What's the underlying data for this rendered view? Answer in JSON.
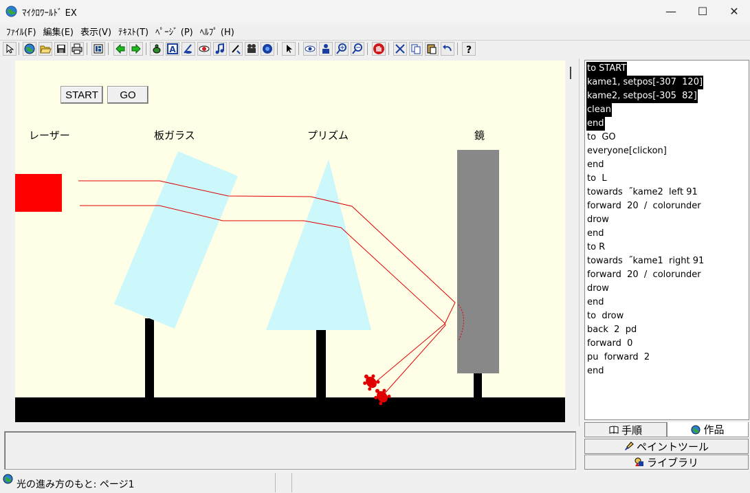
{
  "window": {
    "title": "ﾏｲｸﾛﾜｰﾙﾄﾞ EX",
    "minimize_glyph": "—",
    "maximize_glyph": "☐",
    "close_glyph": "✕"
  },
  "menu": {
    "file": "ﾌｧｲﾙ(F)",
    "edit": "編集(E)",
    "view": "表示(V)",
    "text": "ﾃｷｽﾄ(T)",
    "page": "ﾍﾟｰｼﾞ (P)",
    "help": "ﾍﾙﾌﾟ (H)"
  },
  "toolbar": {
    "icons": [
      "select-arrow-icon",
      "globe-icon",
      "open-folder-icon",
      "save-disk-icon",
      "print-icon",
      "page-icon",
      "arrow-left-icon",
      "arrow-right-icon",
      "turtle-icon",
      "text-box-icon",
      "pen-turtle-icon",
      "eye-stamp-icon",
      "music-note-icon",
      "paint-icon",
      "video-camera-icon",
      "record-icon",
      "pointer-icon",
      "eye-icon",
      "person-icon",
      "zoom-in-icon",
      "zoom-out-icon",
      "stop-hand-icon",
      "cut-icon",
      "copy-icon",
      "paste-icon",
      "undo-icon",
      "help-icon"
    ]
  },
  "canvas": {
    "start_button": "START",
    "go_button": "GO",
    "label_laser": "レーザー",
    "label_glass": "板ガラス",
    "label_prism": "プリズム",
    "label_mirror": "鏡",
    "colors": {
      "background": "#ffffe8",
      "laser": "#ff0000",
      "glass": "#ccf8fc",
      "mirror": "#888888",
      "ground": "#000000"
    }
  },
  "code": {
    "lines": [
      {
        "text": "to START",
        "selected": true
      },
      {
        "text": "kame1, setpos[-307  120]",
        "selected": true
      },
      {
        "text": "kame2, setpos[-305  82]",
        "selected": true
      },
      {
        "text": "clean",
        "selected": true
      },
      {
        "text": "end",
        "selected": true
      },
      {
        "text": "to  GO",
        "selected": false
      },
      {
        "text": "everyone[clickon]",
        "selected": false
      },
      {
        "text": "end",
        "selected": false
      },
      {
        "text": "to  L",
        "selected": false
      },
      {
        "text": "towards  ˝kame2  left 91",
        "selected": false
      },
      {
        "text": "forward  20  /  colorunder",
        "selected": false
      },
      {
        "text": "drow",
        "selected": false
      },
      {
        "text": "end",
        "selected": false
      },
      {
        "text": "to R",
        "selected": false
      },
      {
        "text": "towards  ˝kame1  right 91",
        "selected": false
      },
      {
        "text": "forward  20  /  colorunder",
        "selected": false
      },
      {
        "text": "drow",
        "selected": false
      },
      {
        "text": "end",
        "selected": false
      },
      {
        "text": "to  drow",
        "selected": false
      },
      {
        "text": "back  2  pd",
        "selected": false
      },
      {
        "text": "forward  0",
        "selected": false
      },
      {
        "text": "pu  forward  2",
        "selected": false
      },
      {
        "text": "end",
        "selected": false
      }
    ]
  },
  "tabs": {
    "procedure": "手順",
    "works": "作品",
    "paint_tool": "ペイントツール",
    "library": "ライブラリ"
  },
  "status": {
    "text": "光の進み方のもと: ページ1"
  }
}
